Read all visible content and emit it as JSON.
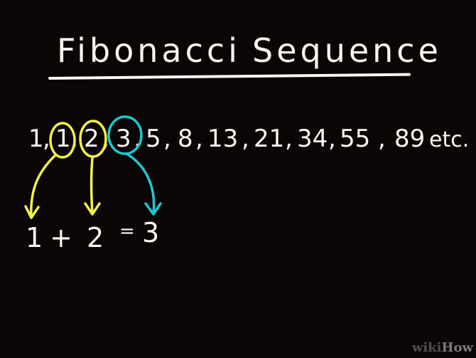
{
  "title": {
    "word1": "Fibonacci",
    "word2": "Sequence"
  },
  "sequence": {
    "terms": [
      "1",
      "1",
      "2",
      "3",
      "5",
      "8",
      "13",
      "21",
      "34",
      "55",
      "89"
    ],
    "separator": ",",
    "suffix": "etc."
  },
  "equation": {
    "left": "1",
    "plus": "+",
    "right": "2",
    "equals": "=",
    "result": "3"
  },
  "colors": {
    "background": "#0b0506",
    "chalk": "#fbf9f3",
    "highlight_yellow": "#f2f04a",
    "highlight_cyan": "#1ec7d3"
  },
  "highlights": [
    {
      "term_index": 1,
      "color": "highlight_yellow",
      "points_to": "equation.left"
    },
    {
      "term_index": 2,
      "color": "highlight_yellow",
      "points_to": "equation.right"
    },
    {
      "term_index": 3,
      "color": "highlight_cyan",
      "points_to": "equation.result"
    }
  ],
  "watermark": {
    "part1": "wiki",
    "part2": "How"
  }
}
